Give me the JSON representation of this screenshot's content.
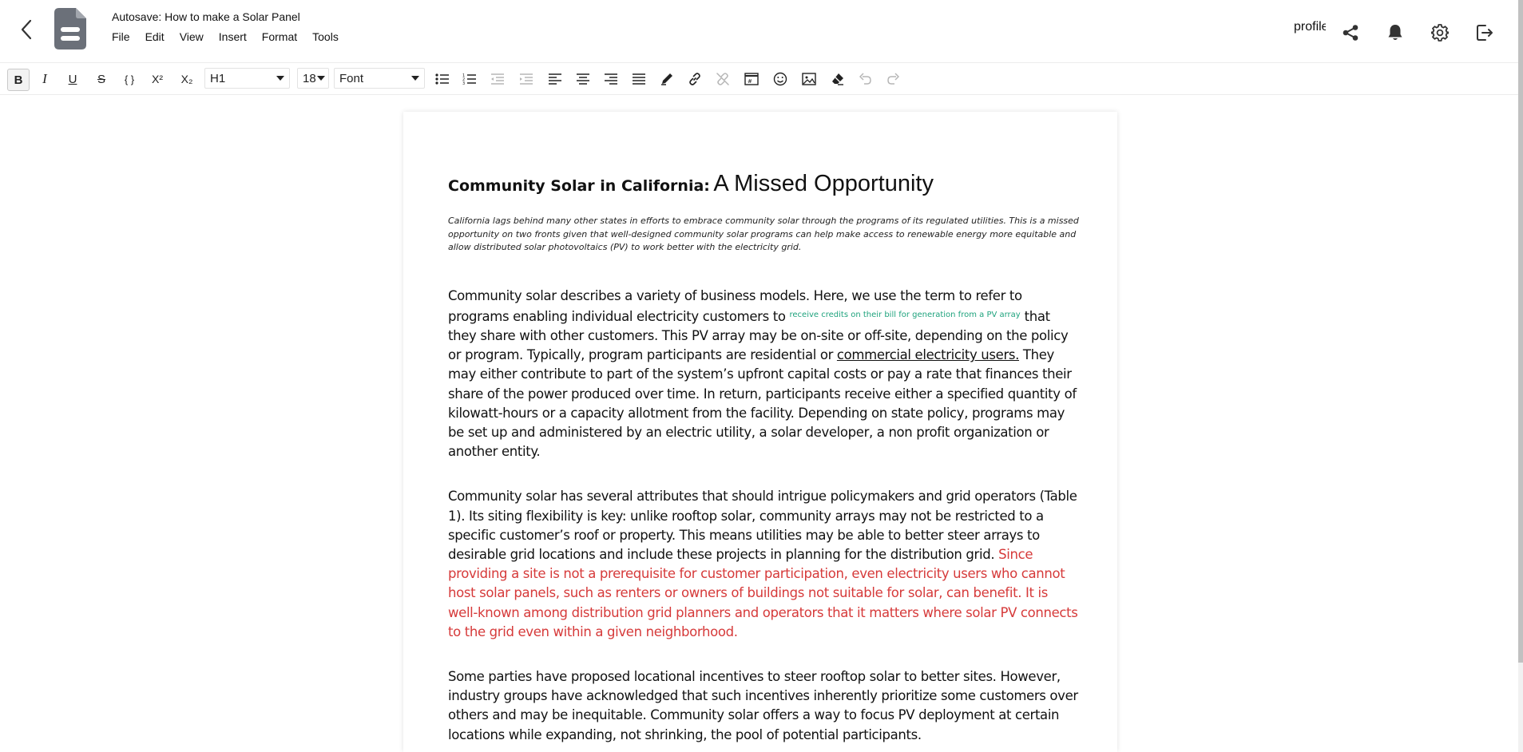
{
  "header": {
    "title": "Autosave: How to make a Solar Panel",
    "menu": [
      "File",
      "Edit",
      "View",
      "Insert",
      "Format",
      "Tools"
    ],
    "profile_label": "profile",
    "icons": [
      "share-icon",
      "bell-icon",
      "gear-icon",
      "logout-icon"
    ]
  },
  "toolbar": {
    "bold": "B",
    "italic": "I",
    "underline": "U",
    "strike": "S",
    "code": "{ }",
    "superscript": "X²",
    "subscript": "X₂",
    "heading_value": "H1",
    "size_value": "18",
    "font_value": "Font"
  },
  "document": {
    "title_bold": "Community Solar in California:",
    "title_rest": "A Missed Opportunity",
    "abstract": "California lags behind many other states in efforts to embrace community solar through the programs of its regulated utilities. This is a missed opportunity on two fronts given that well-designed community solar programs can help make access to renewable energy more equitable and allow distributed solar photovoltaics (PV) to work better with the electricity grid.",
    "p1_a": "Community solar describes a variety of business models. Here, we use the term to refer to programs enabling individual electricity customers to ",
    "p1_note": "receive credits on their bill for generation from a PV array",
    "p1_b": " that they share with other customers. This PV array may be on-site or off-site, depending on the policy or program. Typically, program participants are residential or ",
    "p1_underline": "commercial electricity users.",
    "p1_c": " They may either contribute to part of the system’s upfront  capital costs or pay a rate that finances their share of the power produced over time. In return, participants receive either a specified quantity of kilowatt-hours or a capacity allotment from the facility. Depending on state policy, programs may be set up and administered by an electric utility, a solar developer, a non profit organization or another entity.",
    "p2_a": "Community solar has several attributes that should intrigue policymakers and grid operators (Table 1). Its siting flexibility is key: unlike rooftop solar, community arrays may not be restricted to a specific customer’s roof or property. This means utilities may be able to better steer arrays to desirable grid locations and include these projects in planning for the distribution grid. ",
    "p2_red": "Since providing a site is not a prerequisite for customer participation, even electricity users who cannot host solar panels, such as renters or owners of buildings not suitable for solar, can benefit. It is well-known among distribution grid planners and operators that it matters where solar PV connects to the grid even within a given neighborhood.",
    "p3": "Some parties have proposed locational incentives to steer rooftop solar to better sites. However, industry groups have acknowledged that such incentives inherently prioritize some customers over others and may be inequitable. Community solar offers a way to focus PV deployment at certain locations while expanding, not shrinking, the pool of potential participants."
  },
  "colors": {
    "note_green": "#1fa37d",
    "highlight_red": "#d63a3a",
    "doc_icon": "#6b7079"
  }
}
